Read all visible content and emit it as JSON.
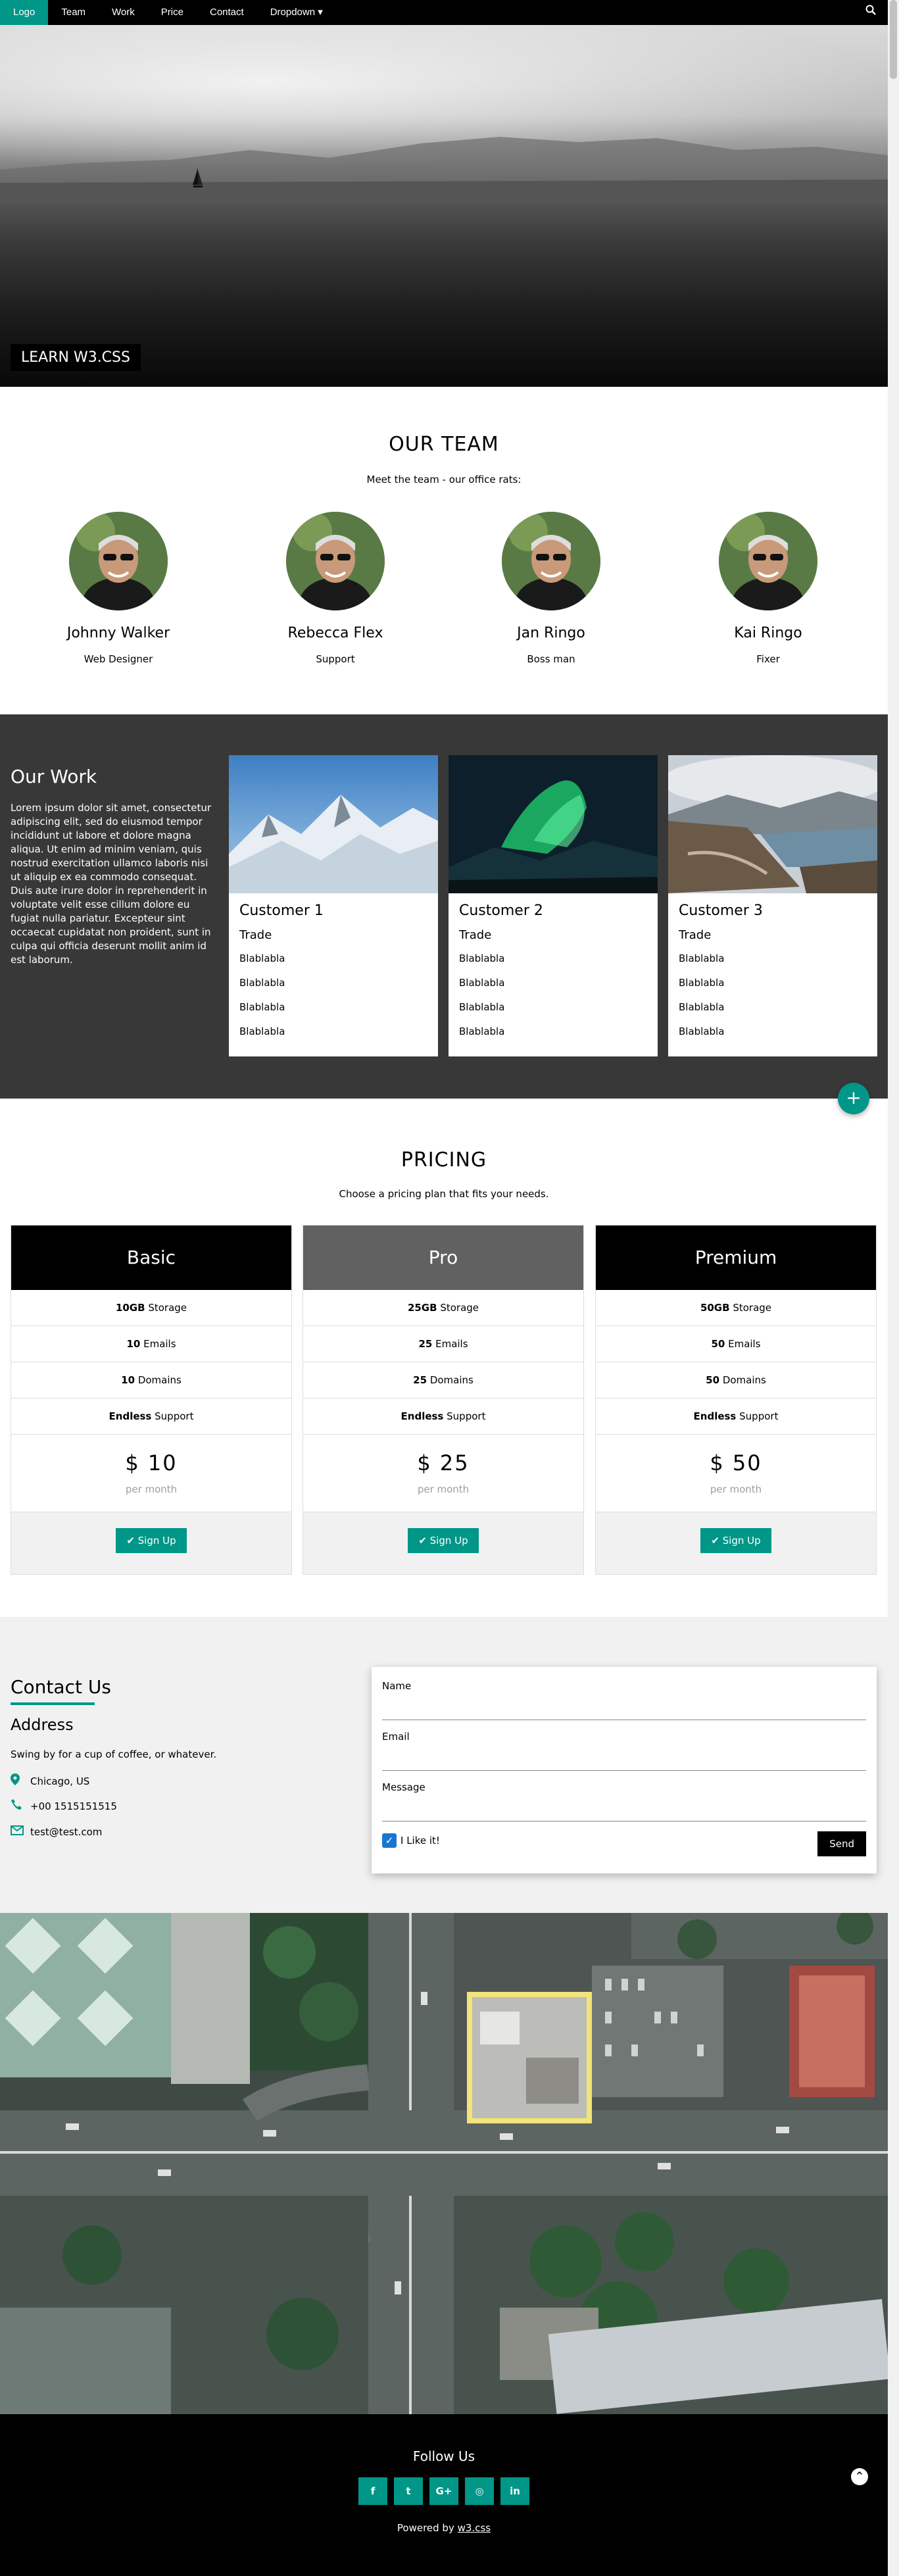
{
  "nav": {
    "logo": "Logo",
    "items": [
      {
        "label": "Team"
      },
      {
        "label": "Work"
      },
      {
        "label": "Price"
      },
      {
        "label": "Contact"
      },
      {
        "label": "Dropdown ▾"
      }
    ],
    "search_icon": "search-icon"
  },
  "hero": {
    "label": "LEARN W3.CSS"
  },
  "team": {
    "title": "OUR TEAM",
    "subtitle": "Meet the team - our office rats:",
    "members": [
      {
        "name": "Johnny Walker",
        "role": "Web Designer"
      },
      {
        "name": "Rebecca Flex",
        "role": "Support"
      },
      {
        "name": "Jan Ringo",
        "role": "Boss man"
      },
      {
        "name": "Kai Ringo",
        "role": "Fixer"
      }
    ]
  },
  "work": {
    "title": "Our Work",
    "text": "Lorem ipsum dolor sit amet, consectetur adipiscing elit, sed do eiusmod tempor incididunt ut labore et dolore magna aliqua. Ut enim ad minim veniam, quis nostrud exercitation ullamco laboris nisi ut aliquip ex ea commodo consequat. Duis aute irure dolor in reprehenderit in voluptate velit esse cillum dolore eu fugiat nulla pariatur. Excepteur sint occaecat cupidatat non proident, sunt in culpa qui officia deserunt mollit anim id est laborum.",
    "cards": [
      {
        "name": "Customer 1",
        "trade": "Trade",
        "lines": [
          "Blablabla",
          "Blablabla",
          "Blablabla",
          "Blablabla"
        ]
      },
      {
        "name": "Customer 2",
        "trade": "Trade",
        "lines": [
          "Blablabla",
          "Blablabla",
          "Blablabla",
          "Blablabla"
        ]
      },
      {
        "name": "Customer 3",
        "trade": "Trade",
        "lines": [
          "Blablabla",
          "Blablabla",
          "Blablabla",
          "Blablabla"
        ]
      }
    ],
    "fab": "+"
  },
  "pricing": {
    "title": "PRICING",
    "subtitle": "Choose a pricing plan that fits your needs.",
    "plans": [
      {
        "name": "Basic",
        "storage": "10GB",
        "emails": "10",
        "domains": "10",
        "support": "Endless",
        "price": "$ 10",
        "per": "per month",
        "button": "✔ Sign Up"
      },
      {
        "name": "Pro",
        "storage": "25GB",
        "emails": "25",
        "domains": "25",
        "support": "Endless",
        "price": "$ 25",
        "per": "per month",
        "button": "✔ Sign Up"
      },
      {
        "name": "Premium",
        "storage": "50GB",
        "emails": "50",
        "domains": "50",
        "support": "Endless",
        "price": "$ 50",
        "per": "per month",
        "button": "✔ Sign Up"
      }
    ],
    "labels": {
      "storage": "Storage",
      "emails": "Emails",
      "domains": "Domains",
      "support": "Support"
    }
  },
  "contact": {
    "title": "Contact Us",
    "address_title": "Address",
    "address_text": "Swing by for a cup of coffee, or whatever.",
    "location": "Chicago, US",
    "phone": "+00 1515151515",
    "email": "test@test.com",
    "form": {
      "name_label": "Name",
      "email_label": "Email",
      "message_label": "Message",
      "checkbox_label": "I Like it!",
      "send": "Send"
    }
  },
  "footer": {
    "follow": "Follow Us",
    "social": [
      "f",
      "t",
      "G+",
      "◎",
      "in"
    ],
    "powered_prefix": "Powered by",
    "powered_link": "w3.css",
    "to_top": "^"
  },
  "colors": {
    "accent": "#009688",
    "dark": "#383838",
    "black": "#000000",
    "pro": "#616161",
    "light": "#f1f1f1"
  }
}
